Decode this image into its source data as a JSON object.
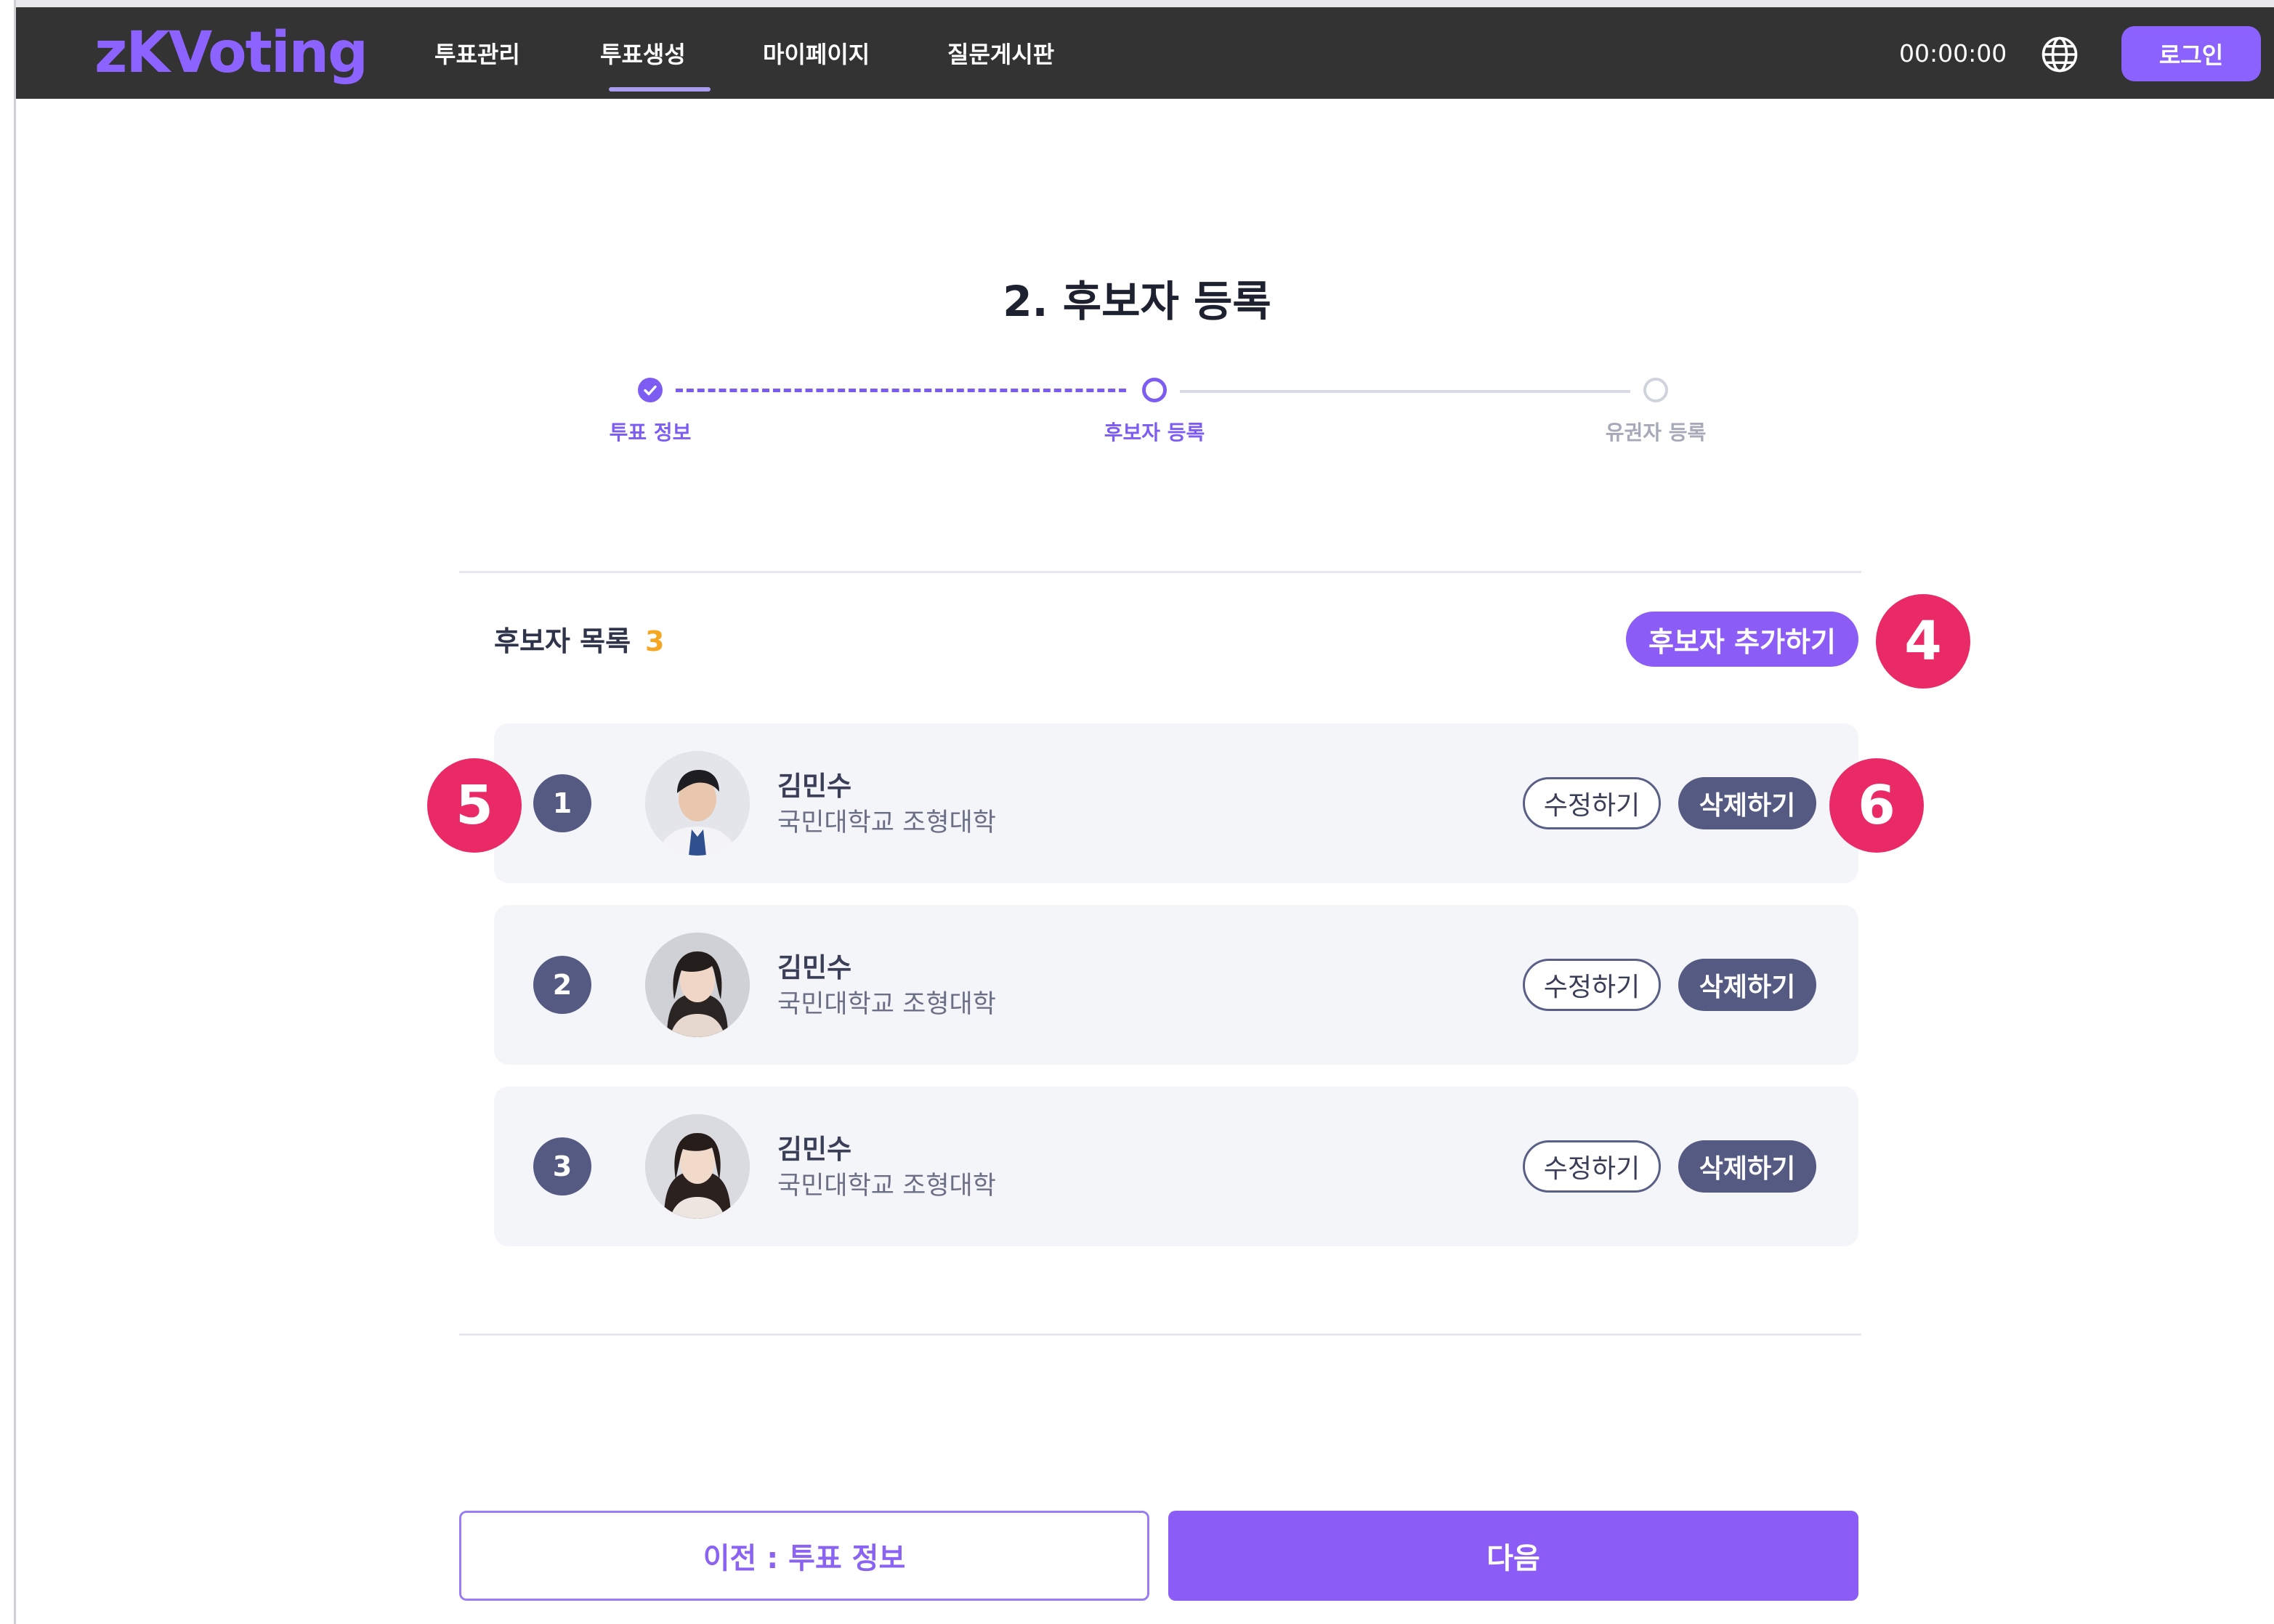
{
  "header": {
    "logo": "zKVoting",
    "nav": [
      {
        "label": "투표관리"
      },
      {
        "label": "투표생성",
        "active": true
      },
      {
        "label": "마이페이지"
      },
      {
        "label": "질문게시판"
      }
    ],
    "timer": "00:00:00",
    "language_icon": "globe-icon",
    "login_label": "로그인"
  },
  "page": {
    "title": "2. 후보자 등록"
  },
  "stepper": {
    "steps": [
      {
        "label": "투표 정보",
        "state": "completed"
      },
      {
        "label": "후보자 등록",
        "state": "current"
      },
      {
        "label": "유권자 등록",
        "state": "upcoming"
      }
    ]
  },
  "candidates": {
    "title": "후보자 목록",
    "count": "3",
    "add_label": "후보자 추가하기",
    "items": [
      {
        "index": "1",
        "name": "김민수",
        "affiliation": "국민대학교 조형대학",
        "edit_label": "수정하기",
        "delete_label": "삭제하기"
      },
      {
        "index": "2",
        "name": "김민수",
        "affiliation": "국민대학교 조형대학",
        "edit_label": "수정하기",
        "delete_label": "삭제하기"
      },
      {
        "index": "3",
        "name": "김민수",
        "affiliation": "국민대학교 조형대학",
        "edit_label": "수정하기",
        "delete_label": "삭제하기"
      }
    ]
  },
  "annotations": {
    "badge_4": "4",
    "badge_5": "5",
    "badge_6": "6"
  },
  "footer": {
    "prev_label": "이전 : 투표 정보",
    "next_label": "다음"
  },
  "colors": {
    "accent": "#8c5cf6",
    "navbar": "#333333",
    "badge": "#ea2a67",
    "count": "#f5a623",
    "slate": "#555a82"
  }
}
